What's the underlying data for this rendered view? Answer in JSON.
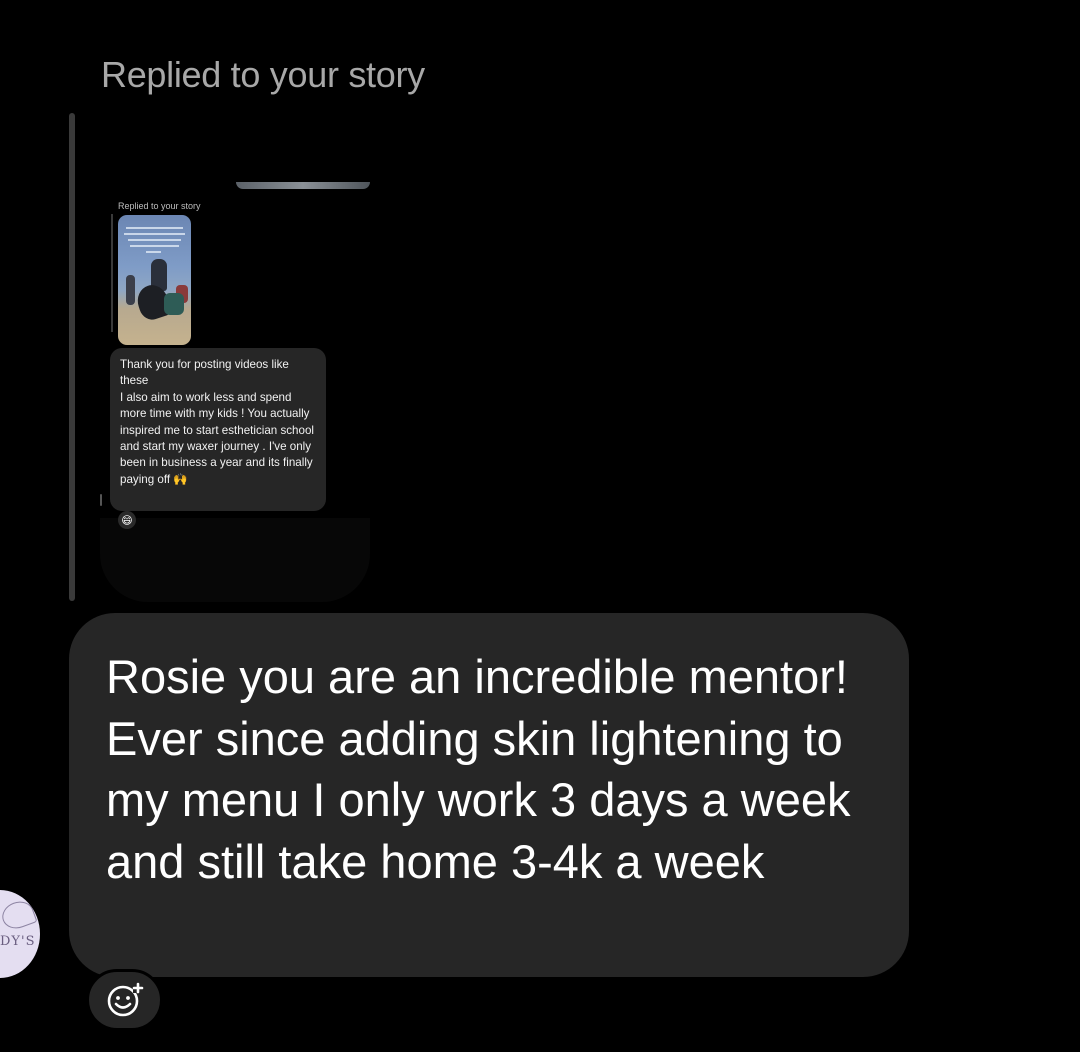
{
  "thread": {
    "replied_label": "Replied to your story"
  },
  "quoted_screenshot": {
    "replied_label": "Replied to your story",
    "message": "Thank you for posting videos like these\nI also aim to work less and spend more time with my kids ! You actually inspired me to start esthetician school and start my waxer journey . I've only been in business a year and its finally paying off 🙌",
    "reaction_emoji": "😄"
  },
  "message": {
    "text": "Rosie you are an incredible mentor! Ever since adding skin lightening to my menu I only work 3 days a week and still take home 3-4k a week"
  },
  "avatar": {
    "monogram": "DY'S"
  },
  "icons": {
    "reaction": "add-reaction-icon"
  },
  "colors": {
    "background": "#000000",
    "bubble": "#262626",
    "muted_text": "#a8a8a8"
  }
}
